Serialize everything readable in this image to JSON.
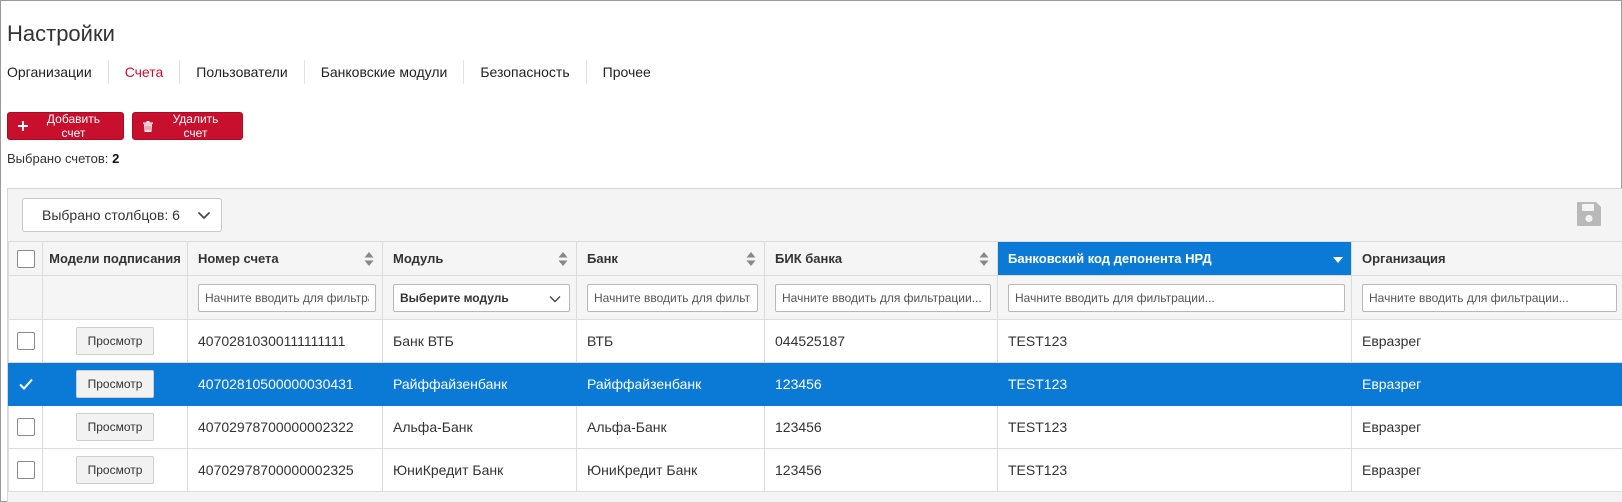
{
  "page": {
    "title": "Настройки"
  },
  "tabs": [
    {
      "label": "Организации",
      "active": false
    },
    {
      "label": "Счета",
      "active": true
    },
    {
      "label": "Пользователи",
      "active": false
    },
    {
      "label": "Банковские модули",
      "active": false
    },
    {
      "label": "Безопасность",
      "active": false
    },
    {
      "label": "Прочее",
      "active": false
    }
  ],
  "toolbar": {
    "add_label": "Добавить счет",
    "delete_label": "Удалить счет",
    "selected_label": "Выбрано счетов:",
    "selected_count": "2"
  },
  "grid": {
    "columns_selector": "Выбрано столбцов: 6",
    "headers": {
      "signing_models": "Модели подписания",
      "account_number": "Номер счета",
      "module": "Модуль",
      "bank": "Банк",
      "bik": "БИК банка",
      "nrd_code": "Банковский код депонента НРД",
      "organization": "Организация"
    },
    "filters": {
      "account_number": "Начните вводить для фильтрации...",
      "module": "Выберите модуль",
      "bank": "Начните вводить для фильтрации...",
      "bik": "Начните вводить для фильтрации...",
      "nrd_code": "Начните вводить для фильтрации...",
      "organization": "Начните вводить для фильтрации..."
    },
    "view_button_label": "Просмотр",
    "rows": [
      {
        "checked": false,
        "account": "40702810300111111111",
        "module": "Банк ВТБ",
        "bank": "ВТБ",
        "bik": "044525187",
        "nrd": "TEST123",
        "org": "Евразрег"
      },
      {
        "checked": true,
        "account": "40702810500000030431",
        "module": "Райффайзенбанк",
        "bank": "Райффайзенбанк",
        "bik": "123456",
        "nrd": "TEST123",
        "org": "Евразрег"
      },
      {
        "checked": false,
        "account": "40702978700000002322",
        "module": "Альфа-Банк",
        "bank": "Альфа-Банк",
        "bik": "123456",
        "nrd": "TEST123",
        "org": "Евразрег"
      },
      {
        "checked": false,
        "account": "40702978700000002325",
        "module": "ЮниКредит Банк",
        "bank": "ЮниКредит Банк",
        "bik": "123456",
        "nrd": "TEST123",
        "org": "Евразрег"
      }
    ]
  },
  "colors": {
    "accent_red": "#c8102e",
    "selection_blue": "#0a7ad6"
  },
  "icons": {
    "add": "plus-icon",
    "delete": "trash-icon",
    "save": "save-icon",
    "dropdown": "chevron-down-icon",
    "sort": "sort-icon",
    "check": "check-icon"
  }
}
